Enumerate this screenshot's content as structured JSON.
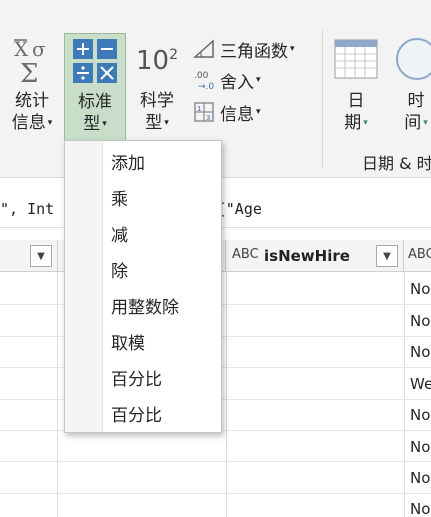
{
  "ribbon": {
    "stats": {
      "line1": "统计",
      "line2": "信息",
      "caret": "▾"
    },
    "standard": {
      "line1": "标准",
      "line2": "型",
      "caret": "▾"
    },
    "scientific": {
      "line1": "科学",
      "line2": "型",
      "caret": "▾",
      "icon_text": "10",
      "icon_sup": "2"
    },
    "trig": {
      "label": "三角函数",
      "caret": "▾"
    },
    "rounding": {
      "label": "舍入",
      "caret": "▾"
    },
    "info": {
      "label": "信息",
      "caret": "▾"
    },
    "date": {
      "line1": "日",
      "line2": "期",
      "caret": "▾"
    },
    "time": {
      "line1": "时",
      "line2": "间",
      "caret": "▾"
    },
    "group_label": "日期 & 时"
  },
  "formula_bar": {
    "text": "\", Int          er\", type text}, {\"Age"
  },
  "columns": [
    {
      "name": "",
      "type": ""
    },
    {
      "name": "",
      "type": ""
    },
    {
      "name": "isNewHire",
      "type": "ABC"
    },
    {
      "name": "",
      "type": "ABC"
    }
  ],
  "rows": [
    "No",
    "No",
    "No",
    "We",
    "No",
    "No",
    "No",
    "No"
  ],
  "menu": {
    "items": [
      "添加",
      "乘",
      "减",
      "除",
      "用整数除",
      "取模",
      "百分比",
      "百分比"
    ]
  }
}
